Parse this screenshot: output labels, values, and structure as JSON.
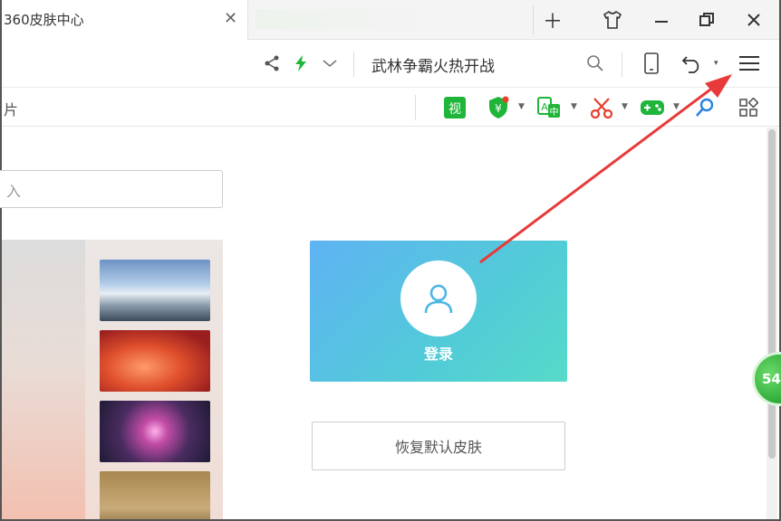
{
  "tab": {
    "title": "360皮肤中心",
    "close_icon": "close-icon"
  },
  "window_controls": [
    "new-tab-icon",
    "skin-icon",
    "minimize-icon",
    "restore-icon",
    "close-icon"
  ],
  "toolbar": {
    "search_hint": "武林争霸火热开战",
    "icons": [
      "share-icon",
      "lightning-icon",
      "chevron-down-icon",
      "search-icon",
      "tablet-icon",
      "undo-icon",
      "menu-icon"
    ]
  },
  "extbar": {
    "left_fragment": "片",
    "extensions": [
      "video-extension-icon",
      "shield-yuan-icon",
      "translate-icon",
      "scissors-icon",
      "gamepad-icon",
      "magnifier-icon",
      "apps-grid-icon"
    ]
  },
  "content": {
    "search_placeholder": "入",
    "login_label": "登录",
    "restore_button": "恢复默认皮肤",
    "float_badge": "54"
  },
  "colors": {
    "accent_green": "#1fb53a",
    "login_card_start": "#5fb3f3",
    "login_card_end": "#56dac8",
    "annotation_arrow": "#e83a3a"
  }
}
